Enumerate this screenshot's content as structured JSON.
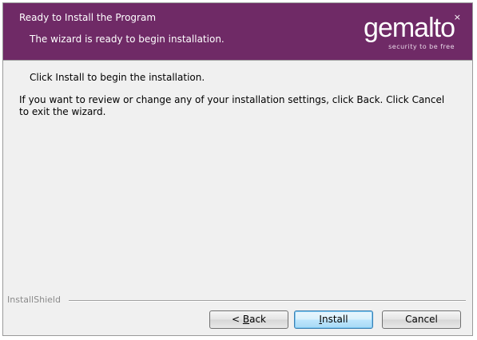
{
  "header": {
    "title": "Ready to Install the Program",
    "subtitle": "The wizard is ready to begin installation.",
    "logo_text": "gemalto",
    "logo_mark": "×",
    "logo_tagline": "security to be free"
  },
  "body": {
    "line1": "Click Install to begin the installation.",
    "line2": "If you want to review or change any of your installation settings, click Back. Click Cancel to exit the wizard."
  },
  "footer": {
    "brand": "InstallShield"
  },
  "buttons": {
    "back_prefix": "< ",
    "back_mnemonic": "B",
    "back_rest": "ack",
    "install_mnemonic": "I",
    "install_rest": "nstall",
    "cancel_label": "Cancel"
  },
  "colors": {
    "header_bg": "#6f2a66",
    "default_button_border": "#3c7fb1"
  }
}
